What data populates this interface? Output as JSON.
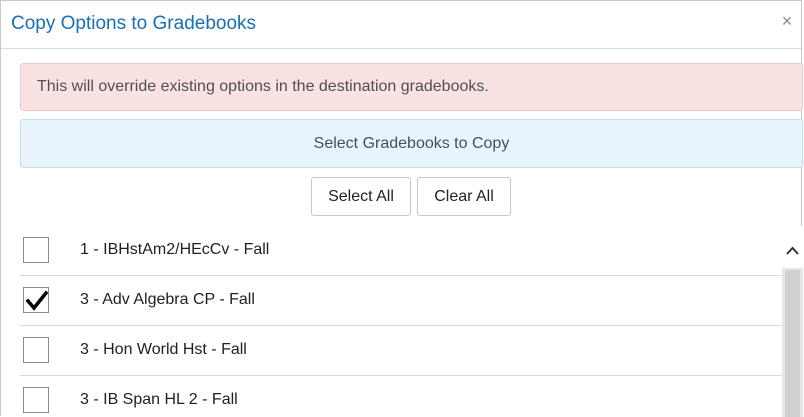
{
  "dialog": {
    "title": "Copy Options to Gradebooks",
    "close_icon": "close-icon"
  },
  "alert": {
    "message": "This will override existing options in the destination gradebooks."
  },
  "info": {
    "message": "Select Gradebooks to Copy"
  },
  "actions": {
    "select_all_label": "Select All",
    "clear_all_label": "Clear All"
  },
  "gradebooks": [
    {
      "label": "1 - IBHstAm2/HEcCv - Fall",
      "checked": false
    },
    {
      "label": "3 - Adv Algebra CP - Fall",
      "checked": true
    },
    {
      "label": "3 - Hon World Hst - Fall",
      "checked": false
    },
    {
      "label": "3 - IB Span HL 2 - Fall",
      "checked": false
    }
  ],
  "colors": {
    "title": "#1a6fb5",
    "alert_bg": "#f9e3e2",
    "info_bg": "#e8f4fb"
  }
}
